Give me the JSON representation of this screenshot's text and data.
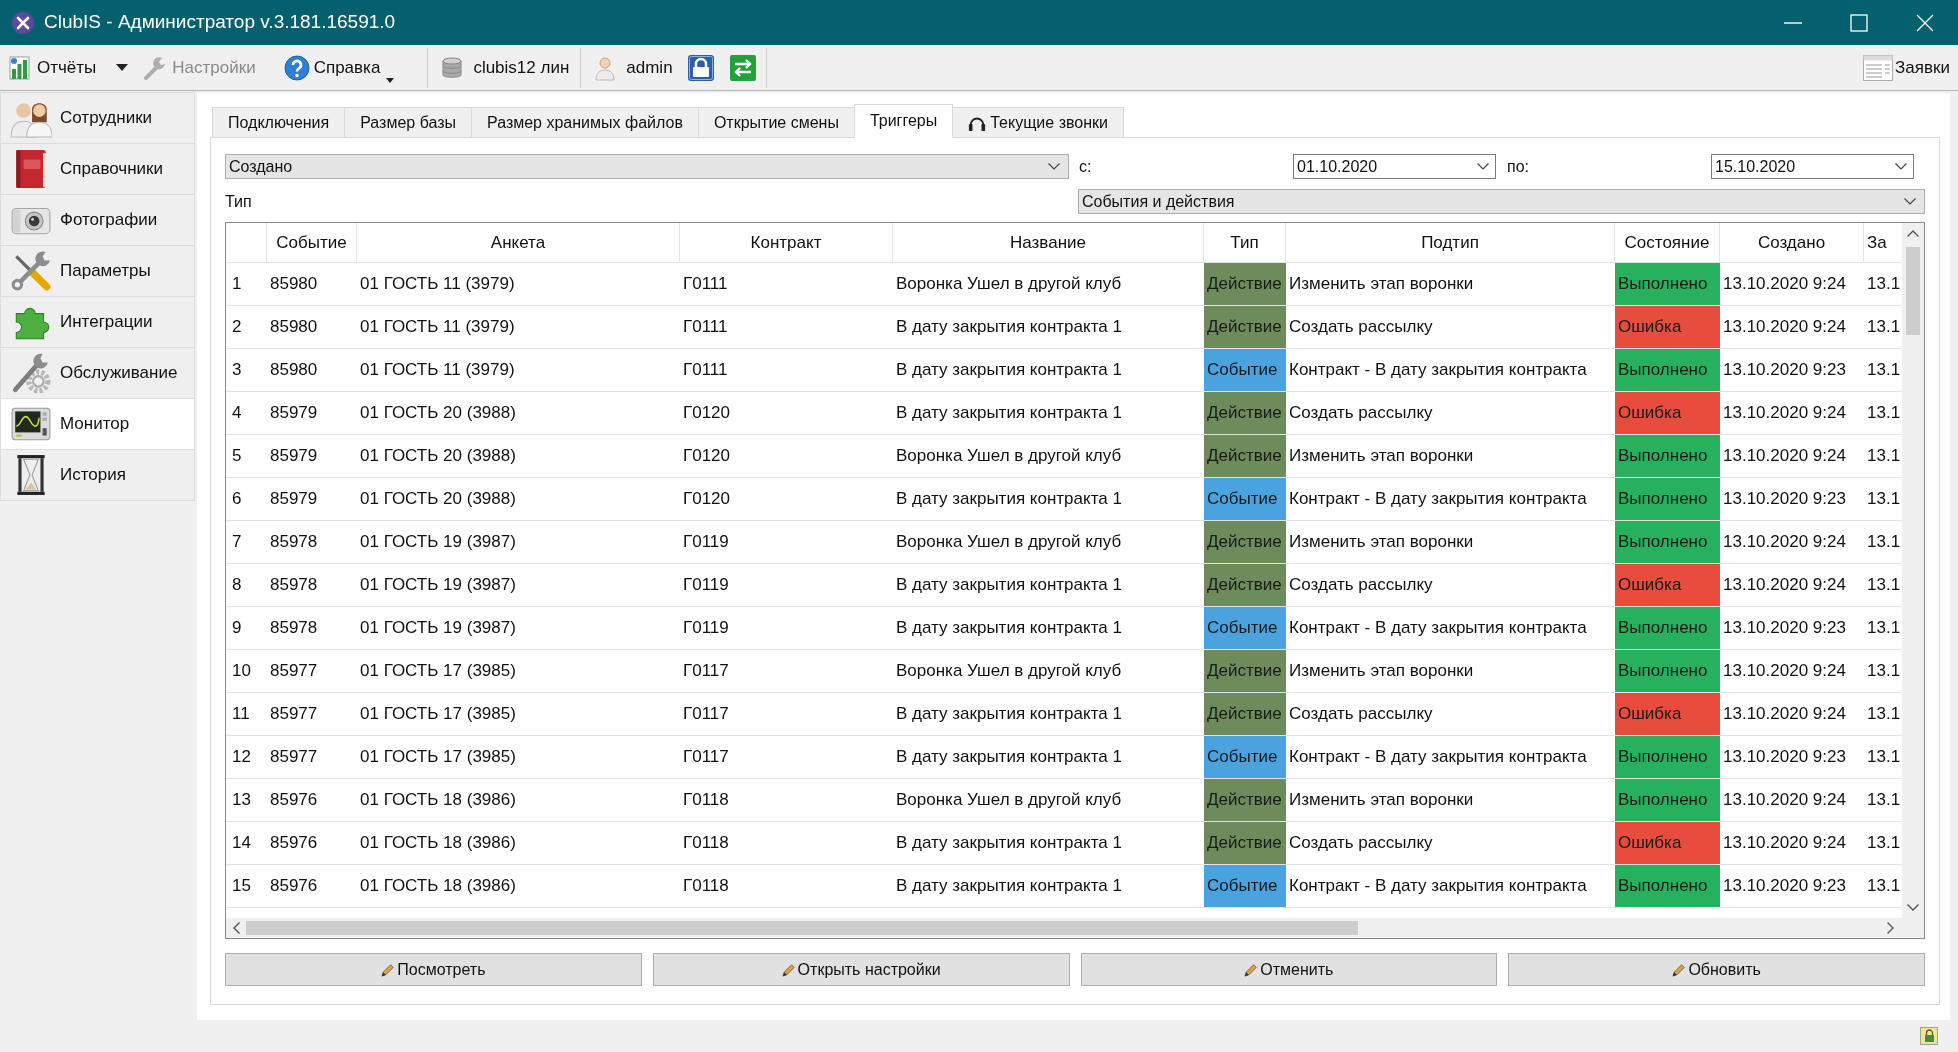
{
  "window": {
    "title": "ClubIS - Администратор v.3.181.16591.0"
  },
  "toolbar": {
    "items": [
      {
        "label": "Отчёты",
        "kind": "split",
        "disabled": false
      },
      {
        "label": "Настройки",
        "kind": "button",
        "disabled": true
      },
      {
        "label": "Справка",
        "kind": "menu",
        "disabled": false
      },
      {
        "label": "clubis12 лин",
        "kind": "label",
        "disabled": false
      },
      {
        "label": "admin",
        "kind": "label",
        "disabled": false
      }
    ],
    "requests_button": {
      "label": "Заявки"
    }
  },
  "sidebar": {
    "items": [
      {
        "label": "Сотрудники",
        "selected": false
      },
      {
        "label": "Справочники",
        "selected": false
      },
      {
        "label": "Фотографии",
        "selected": false
      },
      {
        "label": "Параметры",
        "selected": false
      },
      {
        "label": "Интеграции",
        "selected": false
      },
      {
        "label": "Обслуживание",
        "selected": false
      },
      {
        "label": "Монитор",
        "selected": true
      },
      {
        "label": "История",
        "selected": false
      }
    ]
  },
  "tabs": [
    {
      "label": "Подключения",
      "selected": false
    },
    {
      "label": "Размер базы",
      "selected": false
    },
    {
      "label": "Размер хранимых файлов",
      "selected": false
    },
    {
      "label": "Открытие смены",
      "selected": false
    },
    {
      "label": "Триггеры",
      "selected": true
    },
    {
      "label": "Текущие звонки",
      "selected": false
    }
  ],
  "filters": {
    "field": {
      "value": "Создано"
    },
    "from_label": "с:",
    "from": {
      "value": "01.10.2020"
    },
    "to_label": "по:",
    "to": {
      "value": "15.10.2020"
    },
    "type_label": "Тип",
    "type": {
      "value": "События и действия"
    }
  },
  "table": {
    "columns": [
      "Событие",
      "Анкета",
      "Контракт",
      "Название",
      "Тип",
      "Подтип",
      "Состояние",
      "Создано",
      "За"
    ],
    "rows": [
      {
        "number": "1",
        "cells": [
          "85980",
          "01 ГОСТЬ 11 (3979)",
          "Г0111",
          "Воронка Ушел в другой клуб",
          {
            "text": "Действие",
            "color": "#6d8b5b"
          },
          "Изменить этап воронки",
          {
            "text": "Выполнено",
            "color": "#27b15e"
          },
          "13.10.2020 9:24",
          "13.1"
        ]
      },
      {
        "number": "2",
        "cells": [
          "85980",
          "01 ГОСТЬ 11 (3979)",
          "Г0111",
          "В дату закрытия контракта 1",
          {
            "text": "Действие",
            "color": "#6d8b5b"
          },
          "Создать рассылку",
          {
            "text": "Ошибка",
            "color": "#e74c3c"
          },
          "13.10.2020 9:24",
          "13.1"
        ]
      },
      {
        "number": "3",
        "cells": [
          "85980",
          "01 ГОСТЬ 11 (3979)",
          "Г0111",
          "В дату закрытия контракта 1",
          {
            "text": "Событие",
            "color": "#4aa3df"
          },
          "Контракт - В дату закрытия контракта",
          {
            "text": "Выполнено",
            "color": "#27b15e"
          },
          "13.10.2020 9:23",
          "13.1"
        ]
      },
      {
        "number": "4",
        "cells": [
          "85979",
          "01 ГОСТЬ 20 (3988)",
          "Г0120",
          "В дату закрытия контракта 1",
          {
            "text": "Действие",
            "color": "#6d8b5b"
          },
          "Создать рассылку",
          {
            "text": "Ошибка",
            "color": "#e74c3c"
          },
          "13.10.2020 9:24",
          "13.1"
        ]
      },
      {
        "number": "5",
        "cells": [
          "85979",
          "01 ГОСТЬ 20 (3988)",
          "Г0120",
          "Воронка Ушел в другой клуб",
          {
            "text": "Действие",
            "color": "#6d8b5b"
          },
          "Изменить этап воронки",
          {
            "text": "Выполнено",
            "color": "#27b15e"
          },
          "13.10.2020 9:24",
          "13.1"
        ]
      },
      {
        "number": "6",
        "cells": [
          "85979",
          "01 ГОСТЬ 20 (3988)",
          "Г0120",
          "В дату закрытия контракта 1",
          {
            "text": "Событие",
            "color": "#4aa3df"
          },
          "Контракт - В дату закрытия контракта",
          {
            "text": "Выполнено",
            "color": "#27b15e"
          },
          "13.10.2020 9:23",
          "13.1"
        ]
      },
      {
        "number": "7",
        "cells": [
          "85978",
          "01 ГОСТЬ 19 (3987)",
          "Г0119",
          "Воронка Ушел в другой клуб",
          {
            "text": "Действие",
            "color": "#6d8b5b"
          },
          "Изменить этап воронки",
          {
            "text": "Выполнено",
            "color": "#27b15e"
          },
          "13.10.2020 9:24",
          "13.1"
        ]
      },
      {
        "number": "8",
        "cells": [
          "85978",
          "01 ГОСТЬ 19 (3987)",
          "Г0119",
          "В дату закрытия контракта 1",
          {
            "text": "Действие",
            "color": "#6d8b5b"
          },
          "Создать рассылку",
          {
            "text": "Ошибка",
            "color": "#e74c3c"
          },
          "13.10.2020 9:24",
          "13.1"
        ]
      },
      {
        "number": "9",
        "cells": [
          "85978",
          "01 ГОСТЬ 19 (3987)",
          "Г0119",
          "В дату закрытия контракта 1",
          {
            "text": "Событие",
            "color": "#4aa3df"
          },
          "Контракт - В дату закрытия контракта",
          {
            "text": "Выполнено",
            "color": "#27b15e"
          },
          "13.10.2020 9:23",
          "13.1"
        ]
      },
      {
        "number": "10",
        "cells": [
          "85977",
          "01 ГОСТЬ 17 (3985)",
          "Г0117",
          "Воронка Ушел в другой клуб",
          {
            "text": "Действие",
            "color": "#6d8b5b"
          },
          "Изменить этап воронки",
          {
            "text": "Выполнено",
            "color": "#27b15e"
          },
          "13.10.2020 9:24",
          "13.1"
        ]
      },
      {
        "number": "11",
        "cells": [
          "85977",
          "01 ГОСТЬ 17 (3985)",
          "Г0117",
          "В дату закрытия контракта 1",
          {
            "text": "Действие",
            "color": "#6d8b5b"
          },
          "Создать рассылку",
          {
            "text": "Ошибка",
            "color": "#e74c3c"
          },
          "13.10.2020 9:24",
          "13.1"
        ]
      },
      {
        "number": "12",
        "cells": [
          "85977",
          "01 ГОСТЬ 17 (3985)",
          "Г0117",
          "В дату закрытия контракта 1",
          {
            "text": "Событие",
            "color": "#4aa3df"
          },
          "Контракт - В дату закрытия контракта",
          {
            "text": "Выполнено",
            "color": "#27b15e"
          },
          "13.10.2020 9:23",
          "13.1"
        ]
      },
      {
        "number": "13",
        "cells": [
          "85976",
          "01 ГОСТЬ 18 (3986)",
          "Г0118",
          "Воронка Ушел в другой клуб",
          {
            "text": "Действие",
            "color": "#6d8b5b"
          },
          "Изменить этап воронки",
          {
            "text": "Выполнено",
            "color": "#27b15e"
          },
          "13.10.2020 9:24",
          "13.1"
        ]
      },
      {
        "number": "14",
        "cells": [
          "85976",
          "01 ГОСТЬ 18 (3986)",
          "Г0118",
          "В дату закрытия контракта 1",
          {
            "text": "Действие",
            "color": "#6d8b5b"
          },
          "Создать рассылку",
          {
            "text": "Ошибка",
            "color": "#e74c3c"
          },
          "13.10.2020 9:24",
          "13.1"
        ]
      },
      {
        "number": "15",
        "cells": [
          "85976",
          "01 ГОСТЬ 18 (3986)",
          "Г0118",
          "В дату закрытия контракта 1",
          {
            "text": "Событие",
            "color": "#4aa3df"
          },
          "Контракт - В дату закрытия контракта",
          {
            "text": "Выполнено",
            "color": "#27b15e"
          },
          "13.10.2020 9:23",
          "13.1"
        ]
      }
    ]
  },
  "buttons": [
    {
      "label": "Посмотреть"
    },
    {
      "label": "Открыть настройки"
    },
    {
      "label": "Отменить"
    },
    {
      "label": "Обновить"
    }
  ]
}
